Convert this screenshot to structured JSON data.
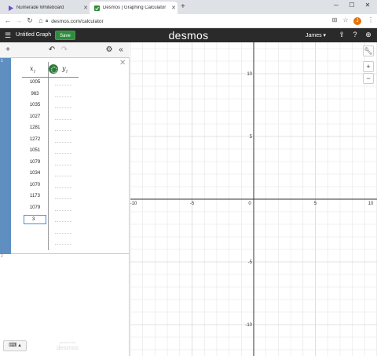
{
  "browser": {
    "tabs": [
      {
        "title": "Numerade Whiteboard",
        "active": false,
        "icon": "play-triangle-icon"
      },
      {
        "title": "Desmos | Graphing Calculator",
        "active": true,
        "icon": "desmos-icon"
      }
    ],
    "url": "desmos.com/calculator",
    "avatar_letter": "J"
  },
  "header": {
    "graph_title": "Untitled Graph",
    "save_label": "Save",
    "logo": "desmos",
    "user": "James ▾"
  },
  "table": {
    "x_header": "x",
    "x_sub": "1",
    "y_header": "y",
    "y_sub": "1",
    "x_values": [
      "1005",
      "963",
      "1035",
      "1027",
      "1281",
      "1272",
      "1051",
      "1079",
      "1034",
      "1070",
      "1173",
      "1079"
    ],
    "editing_value": "3",
    "row_number": "1",
    "next_row_number": "2"
  },
  "powered_by": {
    "line1": "powered by",
    "line2": "desmos"
  },
  "graph": {
    "x_range": [
      -10,
      10
    ],
    "y_range": [
      -12.5,
      12.5
    ],
    "x_ticks": [
      "-10",
      "-5",
      "0",
      "5",
      "10"
    ],
    "y_ticks": [
      "10",
      "5",
      "-5",
      "-10"
    ],
    "grid": true,
    "colors": {
      "grid_minor": "#e6e6e6",
      "grid_major": "#c8c8c8",
      "axis": "#333333",
      "point_color": "#2d7a3a",
      "row_tab": "#5f8fc1",
      "save": "#2f8c3e"
    }
  }
}
